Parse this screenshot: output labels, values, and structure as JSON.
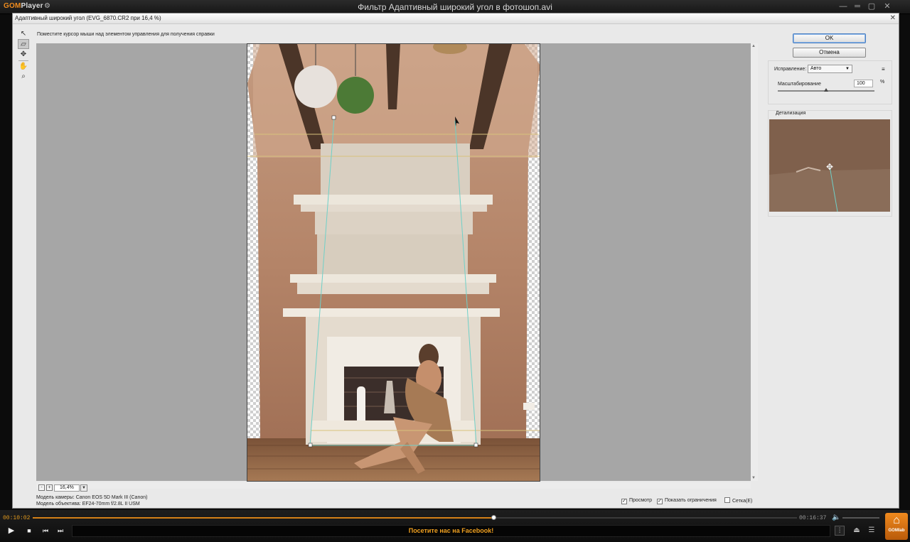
{
  "player": {
    "logo_brand": "GOM",
    "logo_suffix": "Player",
    "title": "Фильтр Адаптивный широкий угол в фотошоп.avi",
    "time_current": "00:10:02",
    "time_total": "00:16:37",
    "progress": 0.604,
    "banner": "Посетите нас на Facebook!",
    "gomlab_label": "GOMlab",
    "accent": "#f08c1e"
  },
  "dialog": {
    "title": "Адаптивный широкий угол (EVG_6870.CR2 при 16,4 %)",
    "hint": "Поместите курсор мыши над элементом управления для получения справки",
    "ok_label": "OK",
    "cancel_label": "Отмена",
    "correction_label": "Исправление:",
    "correction_value": "Авто",
    "scale_label": "Масштабирование",
    "scale_value": "100",
    "scale_unit": "%",
    "scale_level": 0.5,
    "detail_label": "Детализация",
    "zoom_value": "16,4%",
    "zoom_minus": "-",
    "zoom_plus": "+",
    "camera_model": "Модель камеры: Canon EOS 5D Mark III (Canon)",
    "lens_model": "Модель объектива: EF24-70mm f/2.8L II USM",
    "preview_label": "Просмотр",
    "preview_checked": true,
    "constraints_label": "Показать ограничения",
    "constraints_checked": true,
    "grid_label": "Сетка(E)",
    "grid_checked": false
  },
  "tools": [
    "constraint-tool",
    "polygon-constraint-tool",
    "move-tool",
    "hand-tool",
    "zoom-tool"
  ]
}
